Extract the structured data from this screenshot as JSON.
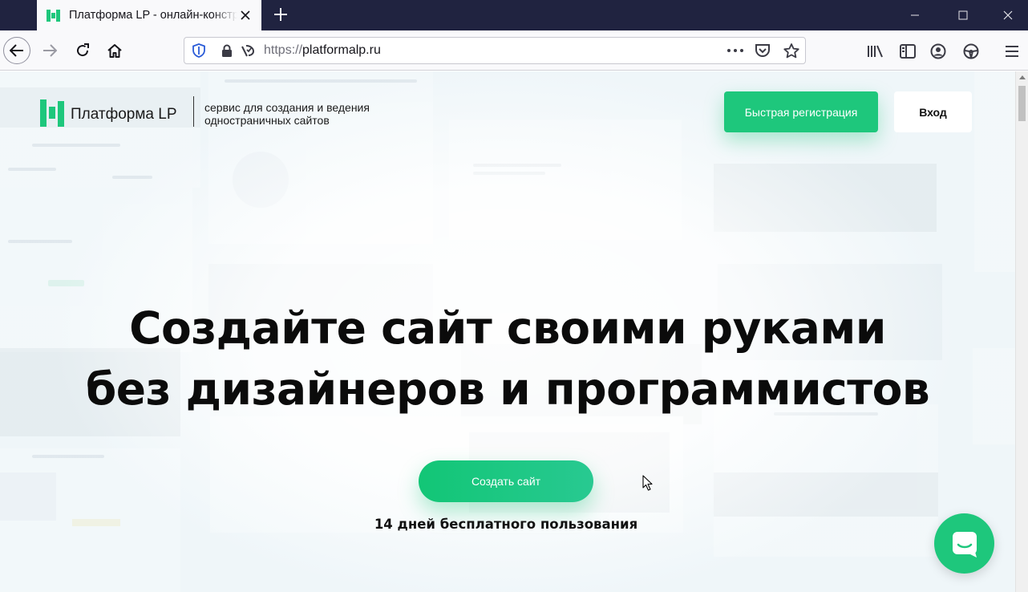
{
  "browser": {
    "tab_title": "Платформа LP - онлайн-конструктор",
    "url_scheme": "https://",
    "url_host": "platformalp.ru",
    "accent_color": "#1ec77c"
  },
  "icons": {
    "back": "arrow-left-icon",
    "forward": "arrow-right-icon",
    "reload": "reload-icon",
    "home": "home-icon",
    "tracking": "shield-icon",
    "lock": "lock-icon",
    "permissions": "permissions-icon",
    "page_actions": "more-dots-icon",
    "pocket": "pocket-icon",
    "bookmark": "star-icon",
    "library": "library-icon",
    "sidebar": "sidebar-icon",
    "account": "account-icon",
    "extension": "extension-icon",
    "menu": "hamburger-menu-icon",
    "chat": "chat-icon"
  },
  "page": {
    "logo_text": "Платформа LP",
    "tagline_line1": "сервис для создания и ведения",
    "tagline_line2": "одностраничных сайтов",
    "register_button": "Быстрая регистрация",
    "login_button": "Вход",
    "headline_line1": "Создайте сайт своими руками",
    "headline_line2": "без дизайнеров и программистов",
    "create_button": "Создать сайт",
    "trial_text": "14 дней бесплатного пользования"
  }
}
